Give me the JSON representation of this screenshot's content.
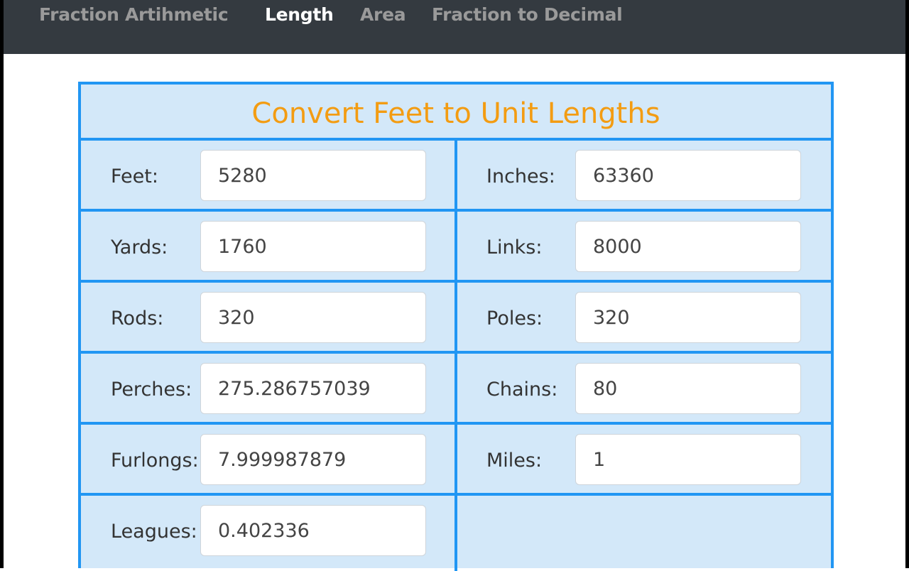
{
  "nav": {
    "items": [
      "Fraction Artihmetic",
      "Length",
      "Area",
      "Fraction to Decimal"
    ],
    "active": "Length"
  },
  "converter": {
    "title": "Convert Feet to Unit Lengths",
    "fields": [
      {
        "label": "Feet:",
        "value": "5280"
      },
      {
        "label": "Inches:",
        "value": "63360"
      },
      {
        "label": "Yards:",
        "value": "1760"
      },
      {
        "label": "Links:",
        "value": "8000"
      },
      {
        "label": "Rods:",
        "value": "320"
      },
      {
        "label": "Poles:",
        "value": "320"
      },
      {
        "label": "Perches:",
        "value": "275.286757039"
      },
      {
        "label": "Chains:",
        "value": "80"
      },
      {
        "label": "Furlongs:",
        "value": "7.999987879"
      },
      {
        "label": "Miles:",
        "value": "1"
      },
      {
        "label": "Leagues:",
        "value": "0.402336"
      }
    ]
  },
  "colors": {
    "navbar_bg": "#343a40",
    "nav_inactive": "#9a9a9a",
    "nav_active": "#ffffff",
    "panel_bg": "#d3e8f9",
    "panel_border": "#2196f3",
    "title": "#f39c12"
  }
}
